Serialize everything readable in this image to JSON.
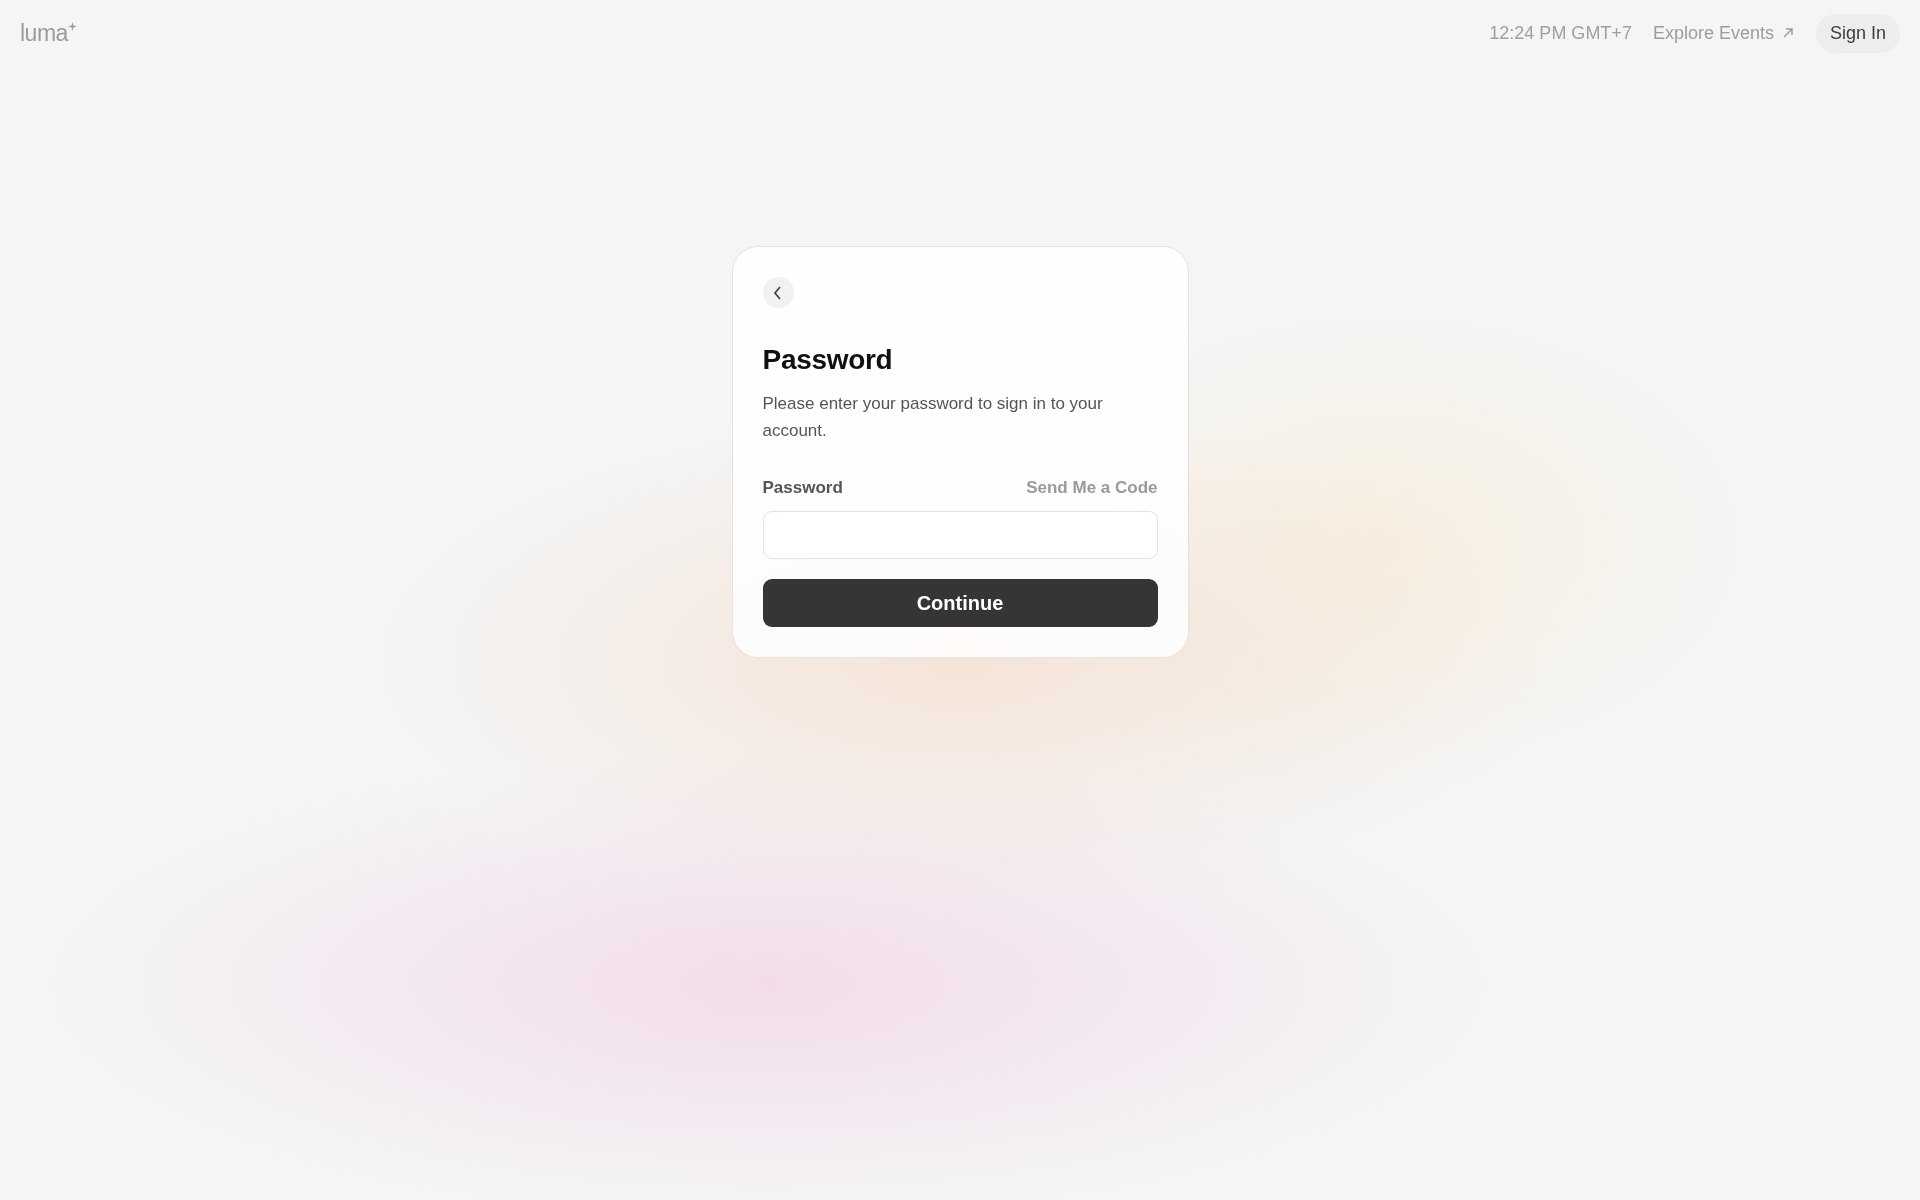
{
  "header": {
    "logo": "luma",
    "time": "12:24 PM GMT+7",
    "explore_link": "Explore Events",
    "sign_in": "Sign In"
  },
  "card": {
    "title": "Password",
    "description": "Please enter your password to sign in to your account.",
    "field_label": "Password",
    "code_link": "Send Me a Code",
    "submit": "Continue"
  }
}
